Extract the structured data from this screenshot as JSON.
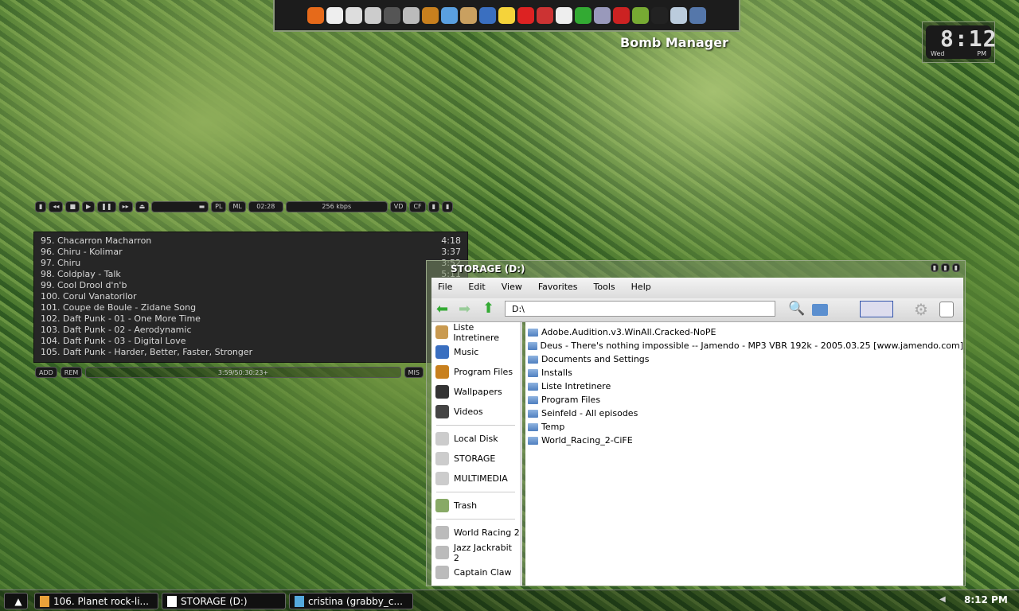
{
  "dock": {
    "icons": [
      "firefox-icon",
      "clock-icon",
      "mail-icon",
      "calendar-icon",
      "camera-icon",
      "phone-icon",
      "cabinet-icon",
      "brushes-icon",
      "clipboard-icon",
      "paint-icon",
      "smiley-icon",
      "heart-icon",
      "cd-icon",
      "notepad-icon",
      "terminal-icon",
      "gear-icon",
      "red-badge-icon",
      "green-badge-icon",
      "bomb-icon",
      "weather-icon",
      "flag-icon"
    ],
    "label": "Bomb Manager"
  },
  "clock": {
    "time": "8:12",
    "day": "Wed",
    "ampm": "PM"
  },
  "winamp": {
    "pl": "PL",
    "ml": "ML",
    "time": "02:28",
    "bitrate": "256 kbps",
    "vd": "VD",
    "cf": "CF",
    "add": "ADD",
    "rem": "REM",
    "misc": "MIS",
    "total": "3:59/50:30:23+",
    "playlist": [
      {
        "t": "95. Chacarron Macharron",
        "d": "4:18"
      },
      {
        "t": "96. Chiru - Kolimar",
        "d": "3:37"
      },
      {
        "t": "97. Chiru",
        "d": "3:52"
      },
      {
        "t": "98. Coldplay - Talk",
        "d": "5:11"
      },
      {
        "t": "99. Cool Drool d'n'b",
        "d": ""
      },
      {
        "t": "100. Corul Vanatorilor",
        "d": ""
      },
      {
        "t": "101. Coupe de Boule - Zidane Song",
        "d": ""
      },
      {
        "t": "102. Daft Punk - 01 - One More Time",
        "d": ""
      },
      {
        "t": "103. Daft Punk - 02 - Aerodynamic",
        "d": ""
      },
      {
        "t": "104. Daft Punk - 03 - Digital Love",
        "d": ""
      },
      {
        "t": "105. Daft Punk - Harder, Better, Faster, Stronger",
        "d": ""
      }
    ]
  },
  "explorer": {
    "title": "STORAGE (D:)",
    "menu": [
      "File",
      "Edit",
      "View",
      "Favorites",
      "Tools",
      "Help"
    ],
    "address": "D:\\",
    "sidebar": [
      [
        "Liste Intretinere",
        "Music",
        "Program Files",
        "Wallpapers",
        "Videos"
      ],
      [
        "Local Disk",
        "STORAGE",
        "MULTIMEDIA"
      ],
      [
        "Trash"
      ],
      [
        "World Racing 2",
        "Jazz Jackrabit 2",
        "Captain Claw"
      ]
    ],
    "files": [
      "Adobe.Audition.v3.WinAll.Cracked-NoPE",
      "Deus - There's nothing impossible -- Jamendo - MP3 VBR 192k - 2005.03.25 [www.jamendo.com]",
      "Documents and Settings",
      "Installs",
      "Liste Intretinere",
      "Program Files",
      "Seinfeld - All episodes",
      "Temp",
      "World_Racing_2-CiFE"
    ]
  },
  "taskbar": {
    "tasks": [
      "106. Planet rock-li...",
      "STORAGE (D:)",
      "cristina (grabby_c..."
    ],
    "time": "8:12 PM"
  }
}
